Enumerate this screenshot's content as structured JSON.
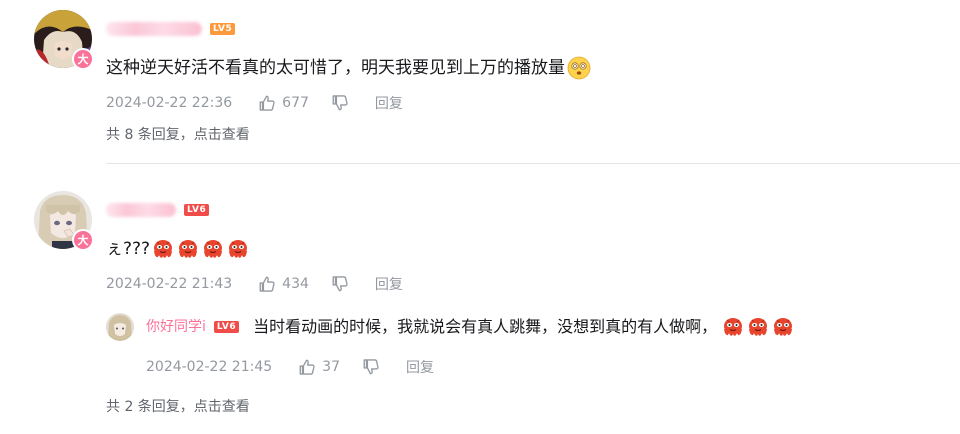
{
  "comments": [
    {
      "level": "LV5",
      "text": "这种逆天好活不看真的太可惜了，明天我要见到上万的播放量",
      "emoji": "dazed-face-emoji",
      "time": "2024-02-22 22:36",
      "likes": "677",
      "reply_label": "回复",
      "reply_summary": "共 8 条回复，点击查看",
      "vip_badge": "大"
    },
    {
      "level": "LV6",
      "text": "ぇ???",
      "emoji": "red-octopus-emoji",
      "time": "2024-02-22 21:43",
      "likes": "434",
      "reply_label": "回复",
      "reply_summary": "共 2 条回复，点击查看",
      "vip_badge": "大",
      "sub_reply": {
        "username": "你好同学i",
        "level": "LV6",
        "text": "当时看动画的时候，我就说会有真人跳舞，没想到真的有人做啊，",
        "emoji": "red-octopus-emoji",
        "time": "2024-02-22 21:45",
        "likes": "37",
        "reply_label": "回复"
      }
    }
  ],
  "colors": {
    "accent": "#fb7299",
    "lv5": "#ff9a3c",
    "lv6": "#f04c49",
    "meta": "#9499a0"
  }
}
